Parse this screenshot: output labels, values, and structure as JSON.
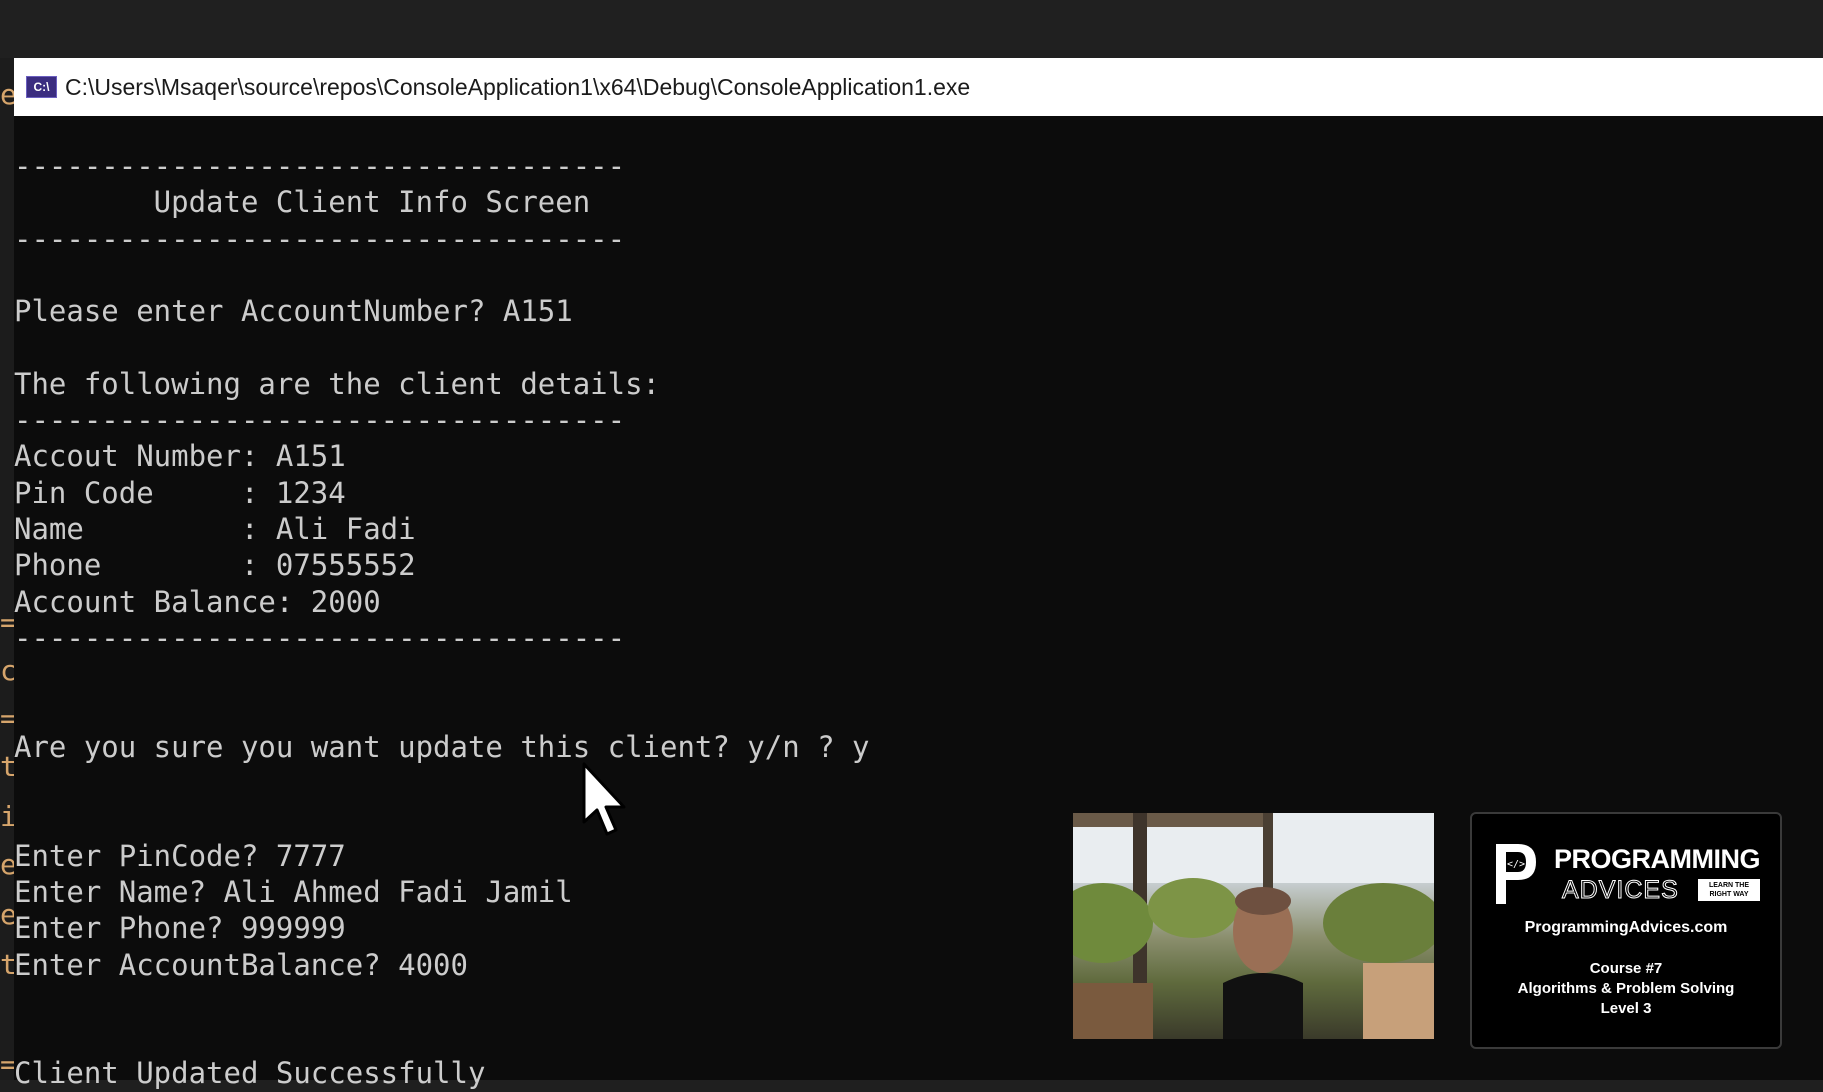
{
  "window": {
    "title": "C:\\Users\\Msaqer\\source\\repos\\ConsoleApplication1\\x64\\Debug\\ConsoleApplication1.exe",
    "icon_label": "C:\\",
    "icon": "console-app-icon"
  },
  "console": {
    "lines": [
      "-----------------------------------",
      "        Update Client Info Screen",
      "-----------------------------------",
      "",
      "Please enter AccountNumber? A151",
      "",
      "The following are the client details:",
      "-----------------------------------",
      "Accout Number: A151",
      "Pin Code     : 1234",
      "Name         : Ali Fadi",
      "Phone        : 07555552",
      "Account Balance: 2000",
      "-----------------------------------",
      "",
      "",
      "Are you sure you want update this client? y/n ? y",
      "",
      "",
      "Enter PinCode? 7777",
      "Enter Name? Ali Ahmed Fadi Jamil",
      "Enter Phone? 999999",
      "Enter AccountBalance? 4000",
      "",
      "",
      "Client Updated Successfully"
    ]
  },
  "left_strip": {
    "chars": [
      "e",
      "=",
      "c",
      "=",
      "t",
      "i",
      "e",
      "e",
      "t",
      "="
    ]
  },
  "brand": {
    "logo_mark": "P",
    "logo_code_symbol": "</>",
    "name_line1": "PROGRAMMING",
    "name_line2": "ADVICES",
    "tagline": "LEARN THE RIGHT WAY",
    "url": "ProgrammingAdvices.com",
    "course_line1": "Course #7",
    "course_line2": "Algorithms & Problem Solving",
    "course_line3": "Level 3"
  },
  "colors": {
    "console_bg": "#0c0c0c",
    "console_text": "#cccccc",
    "titlebar_bg": "#ffffff",
    "icon_bg": "#3b2d80"
  }
}
